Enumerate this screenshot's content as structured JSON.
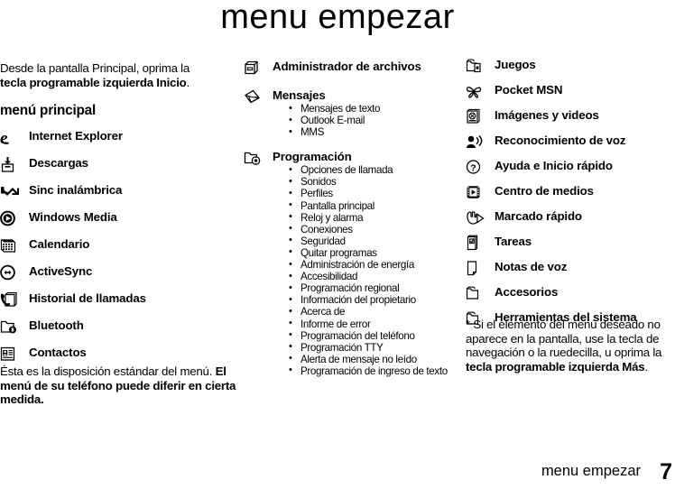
{
  "page": {
    "title": "menu empezar",
    "footer_text": "menu empezar",
    "footer_page_number": "7",
    "text_color": "#000000",
    "background_color": "#ffffff"
  },
  "left_column": {
    "intro_plain_1": "Desde la pantalla Principal, oprima la ",
    "intro_bold_1": "tecla programable izquierda Inicio",
    "intro_plain_2": ".",
    "section_heading": "menú principal",
    "items": [
      {
        "icon": "internet-explorer-icon",
        "label": "Internet Explorer"
      },
      {
        "icon": "descargas-download-icon",
        "label": "Descargas"
      },
      {
        "icon": "sinc-inalambrica-arrows-icon",
        "label": "Sinc inalámbrica"
      },
      {
        "icon": "windows-media-play-icon",
        "label": "Windows Media"
      },
      {
        "icon": "calendario-calendar-icon",
        "label": "Calendario"
      },
      {
        "icon": "activesync-icon",
        "label": "ActiveSync"
      },
      {
        "icon": "historial-de-llamadas-icon",
        "label": "Historial de llamadas"
      },
      {
        "icon": "bluetooth-folder-icon",
        "label": "Bluetooth"
      },
      {
        "icon": "contactos-icon",
        "label": "Contactos"
      }
    ],
    "closing_plain": "Ésta es la disposición estándar del menú. ",
    "closing_bold": "El menú de su teléfono puede diferir en cierta medida."
  },
  "middle_column": {
    "items": [
      {
        "icon": "administrador-de-archivos-icon",
        "label": "Administrador de archivos",
        "sublist": []
      },
      {
        "icon": "mensajes-envelope-icon",
        "label": "Mensajes",
        "sublist": [
          "Mensajes de texto",
          "Outlook E-mail",
          "MMS"
        ]
      },
      {
        "icon": "programacion-settings-folder-icon",
        "label": "Programación",
        "sublist": [
          "Opciones de llamada",
          "Sonidos",
          "Perfiles",
          "Pantalla principal",
          "Reloj y alarma",
          "Conexiones",
          "Seguridad",
          "Quitar programas",
          "Administración de energía",
          "Accesibilidad",
          "Programación regional",
          "Información del propietario",
          "Acerca de",
          "Informe de error",
          "Programación del teléfono",
          "Programación TTY",
          "Alerta de mensaje no leído",
          "Programación de ingreso de texto"
        ]
      }
    ]
  },
  "right_column": {
    "items": [
      {
        "icon": "juegos-games-icon",
        "label": "Juegos"
      },
      {
        "icon": "pocket-msn-butterfly-icon",
        "label": "Pocket MSN"
      },
      {
        "icon": "imagenes-y-videos-icon",
        "label": "Imágenes y videos"
      },
      {
        "icon": "reconocimiento-de-voz-icon",
        "label": "Reconocimiento de voz"
      },
      {
        "icon": "ayuda-question-icon",
        "label": "Ayuda e Inicio rápido"
      },
      {
        "icon": "centro-de-medios-film-icon",
        "label": "Centro de medios"
      },
      {
        "icon": "marcado-rapido-hand-icon",
        "label": "Marcado rápido"
      },
      {
        "icon": "tareas-checklist-icon",
        "label": "Tareas"
      },
      {
        "icon": "notas-de-voz-page-icon",
        "label": "Notas de voz"
      },
      {
        "icon": "accesorios-folder-icon",
        "label": "Accesorios"
      },
      {
        "icon": "herramientas-del-sistema-folder-icon",
        "label": "Herramientas del sistema"
      }
    ],
    "note_plain": "* Si el elemento del menú deseado no aparece en la pantalla, use la tecla de navegación o la ruedecilla, u oprima la ",
    "note_bold": "tecla programable izquierda Más",
    "note_plain_end": "."
  }
}
